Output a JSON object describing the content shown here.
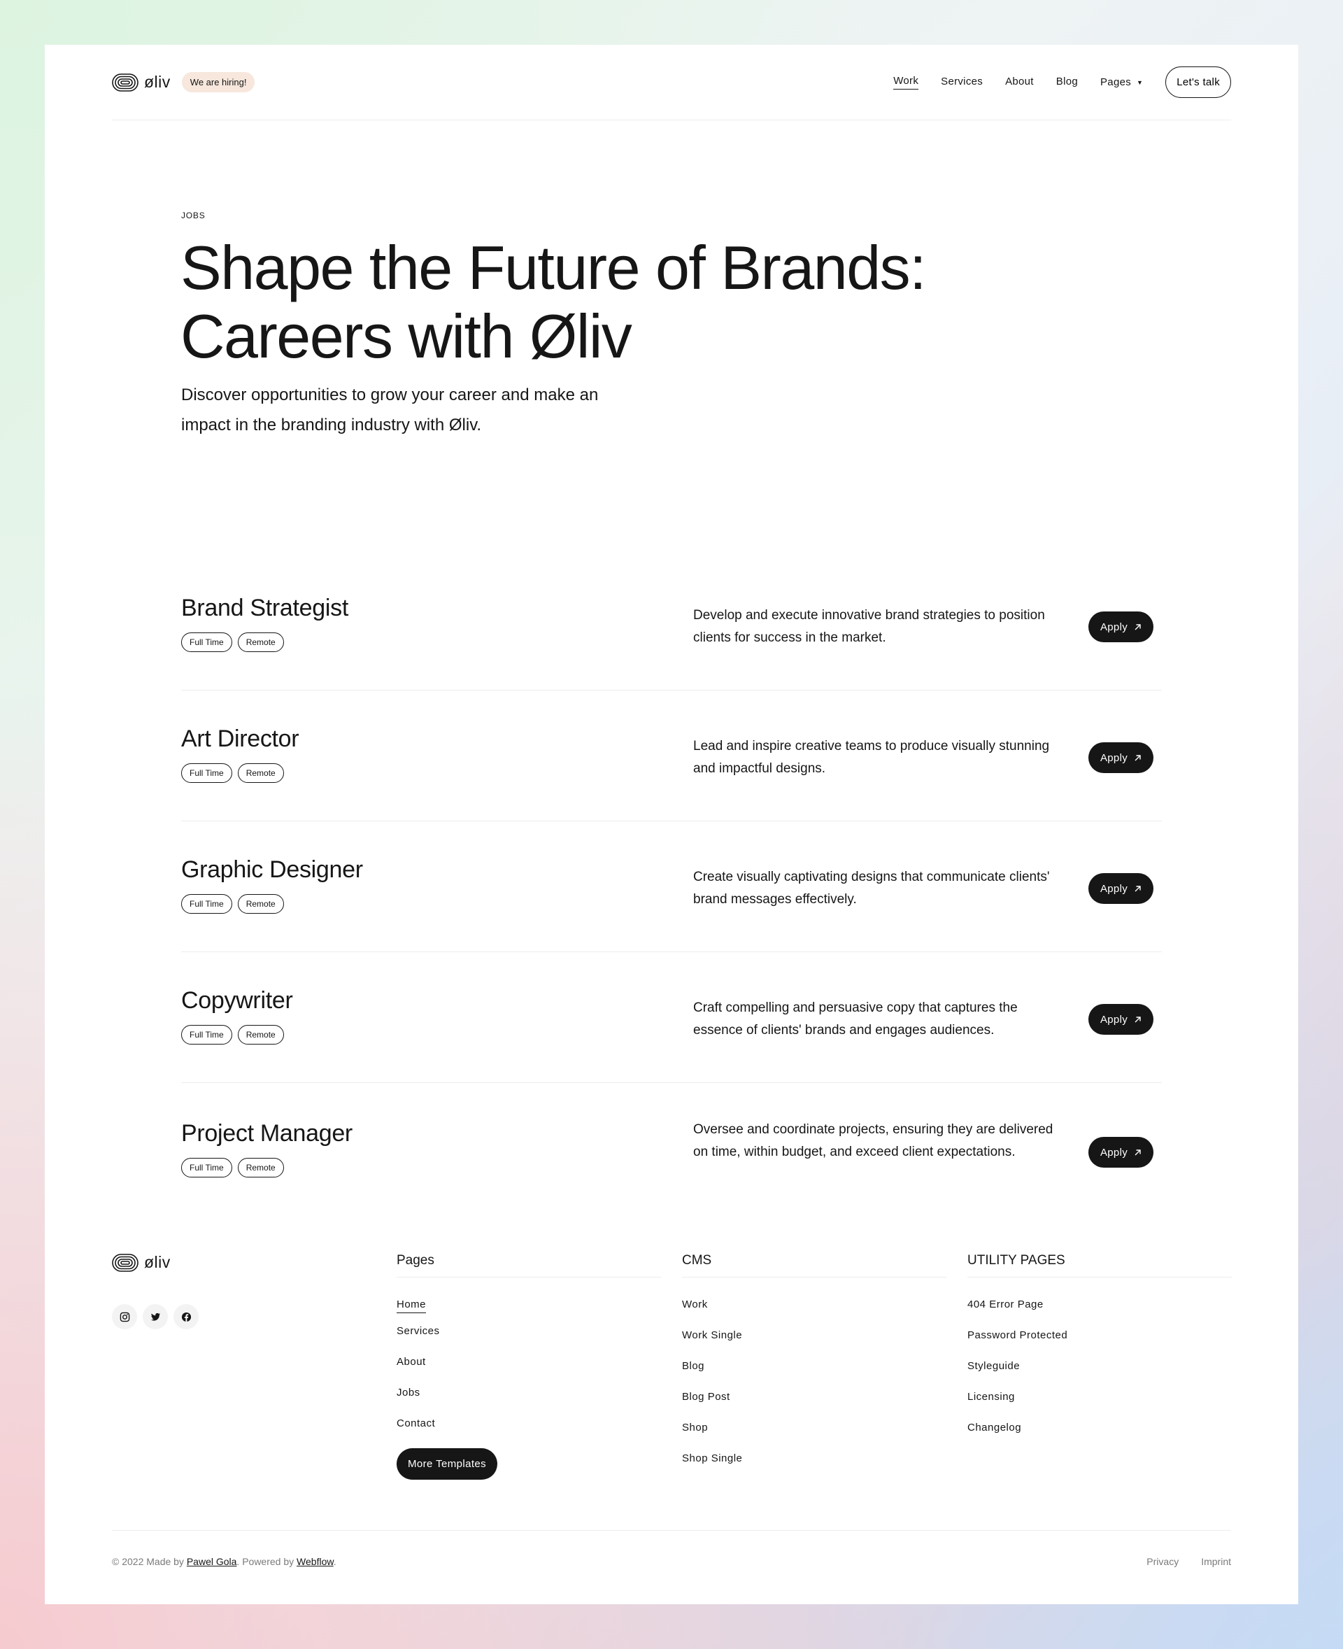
{
  "brand": {
    "name": "øliv",
    "hiring_badge": "We are hiring!"
  },
  "nav": {
    "links": [
      {
        "label": "Work",
        "active": true
      },
      {
        "label": "Services"
      },
      {
        "label": "About"
      },
      {
        "label": "Blog"
      }
    ],
    "pages_label": "Pages",
    "cta_label": "Let's talk"
  },
  "hero": {
    "eyebrow": "JOBS",
    "title_line1": "Shape the Future of Brands:",
    "title_line2": "Careers with Øliv",
    "subtitle": "Discover opportunities to grow your career and make an impact in the branding industry with Øliv."
  },
  "jobs": [
    {
      "title": "Brand Strategist",
      "tags": [
        "Full Time",
        "Remote"
      ],
      "description": "Develop and execute innovative brand strategies to position clients for success in the market.",
      "apply": "Apply"
    },
    {
      "title": "Art Director",
      "tags": [
        "Full Time",
        "Remote"
      ],
      "description": "Lead and inspire creative teams to produce visually stunning and impactful designs.",
      "apply": "Apply"
    },
    {
      "title": "Graphic Designer",
      "tags": [
        "Full Time",
        "Remote"
      ],
      "description": "Create visually captivating designs that communicate clients' brand messages effectively.",
      "apply": "Apply"
    },
    {
      "title": "Copywriter",
      "tags": [
        "Full Time",
        "Remote"
      ],
      "description": "Craft compelling and persuasive copy that captures the essence of clients' brands and engages audiences.",
      "apply": "Apply"
    },
    {
      "title": "Project Manager",
      "tags": [
        "Full Time",
        "Remote"
      ],
      "description": "Oversee and coordinate projects, ensuring they are delivered on time, within budget, and exceed client expectations.",
      "apply": "Apply"
    }
  ],
  "footer": {
    "brand": "øliv",
    "socials": [
      "instagram-icon",
      "twitter-icon",
      "facebook-icon"
    ],
    "pages": {
      "heading": "Pages",
      "links": [
        "Home",
        "Services",
        "About",
        "Jobs",
        "Contact"
      ],
      "button": "More Templates"
    },
    "cms": {
      "heading": "CMS",
      "links": [
        "Work",
        "Work Single",
        "Blog",
        "Blog Post",
        "Shop",
        "Shop Single"
      ]
    },
    "utility": {
      "heading": "UTILITY PAGES",
      "links": [
        "404 Error Page",
        "Password Protected",
        "Styleguide",
        "Licensing",
        "Changelog"
      ]
    },
    "copyright_prefix": "© 2022 Made by",
    "author": "Pawel Gola",
    "powered_prefix": ". Powered by",
    "platform": "Webflow",
    "period": ".",
    "legal": [
      "Privacy",
      "Imprint"
    ]
  },
  "colors": {
    "ink": "#161616",
    "hiring_badge_bg": "#f7e7dc",
    "divider": "#ededed"
  }
}
